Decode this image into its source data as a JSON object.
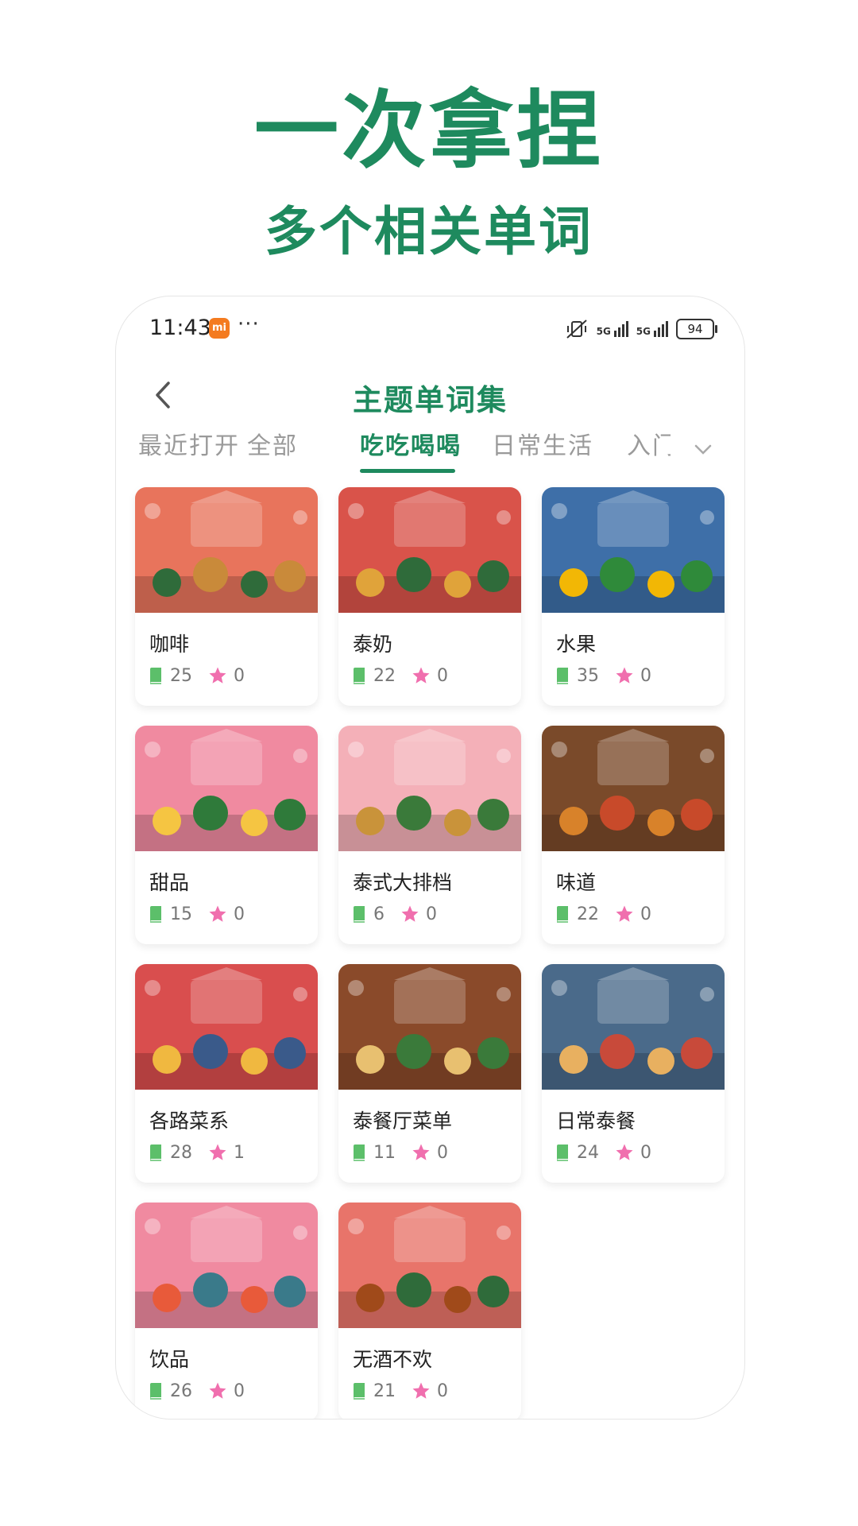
{
  "headline": {
    "line1": "一次拿捏",
    "line2": "多个相关单词"
  },
  "status_bar": {
    "time": "11:43",
    "mi_badge": "mi",
    "dots": "···",
    "net1": "5G",
    "net2": "5G",
    "battery": "94"
  },
  "nav": {
    "title": "主题单词集"
  },
  "tabs": [
    {
      "label": "最近打开"
    },
    {
      "label": "全部"
    },
    {
      "label": "吃吃喝喝",
      "active": true
    },
    {
      "label": "日常生活"
    },
    {
      "label": "入门"
    }
  ],
  "cards": [
    {
      "name": "咖啡",
      "words": "25",
      "stars": "0",
      "bg": "#e8745c",
      "accent": "#2f6b3a",
      "accent2": "#c98a3a"
    },
    {
      "name": "泰奶",
      "words": "22",
      "stars": "0",
      "bg": "#d9534a",
      "accent": "#e0a33a",
      "accent2": "#2f6b3a"
    },
    {
      "name": "水果",
      "words": "35",
      "stars": "0",
      "bg": "#3e6fa8",
      "accent": "#f2b705",
      "accent2": "#2f8a3a"
    },
    {
      "name": "甜品",
      "words": "15",
      "stars": "0",
      "bg": "#f08aa0",
      "accent": "#f5c542",
      "accent2": "#2f7a3a"
    },
    {
      "name": "泰式大排档",
      "words": "6",
      "stars": "0",
      "bg": "#f4b0b8",
      "accent": "#c9933a",
      "accent2": "#3a7a3a"
    },
    {
      "name": "味道",
      "words": "22",
      "stars": "0",
      "bg": "#7a4a2a",
      "accent": "#d8822a",
      "accent2": "#c84a2a"
    },
    {
      "name": "各路菜系",
      "words": "28",
      "stars": "1",
      "bg": "#d94e4e",
      "accent": "#f0b840",
      "accent2": "#3a5a8a"
    },
    {
      "name": "泰餐厅菜单",
      "words": "11",
      "stars": "0",
      "bg": "#8a4a2a",
      "accent": "#e8c070",
      "accent2": "#3a7a3a"
    },
    {
      "name": "日常泰餐",
      "words": "24",
      "stars": "0",
      "bg": "#4a6a8a",
      "accent": "#e8b060",
      "accent2": "#c84a3a"
    },
    {
      "name": "饮品",
      "words": "26",
      "stars": "0",
      "bg": "#f08aa0",
      "accent": "#e85a3a",
      "accent2": "#3a7a8a"
    },
    {
      "name": "无酒不欢",
      "words": "21",
      "stars": "0",
      "bg": "#e8746a",
      "accent": "#a04a1a",
      "accent2": "#2f6b3a"
    }
  ],
  "colors": {
    "brand": "#1e8a5e",
    "book_icon": "#5cbf6a",
    "star_icon": "#f06fae"
  }
}
